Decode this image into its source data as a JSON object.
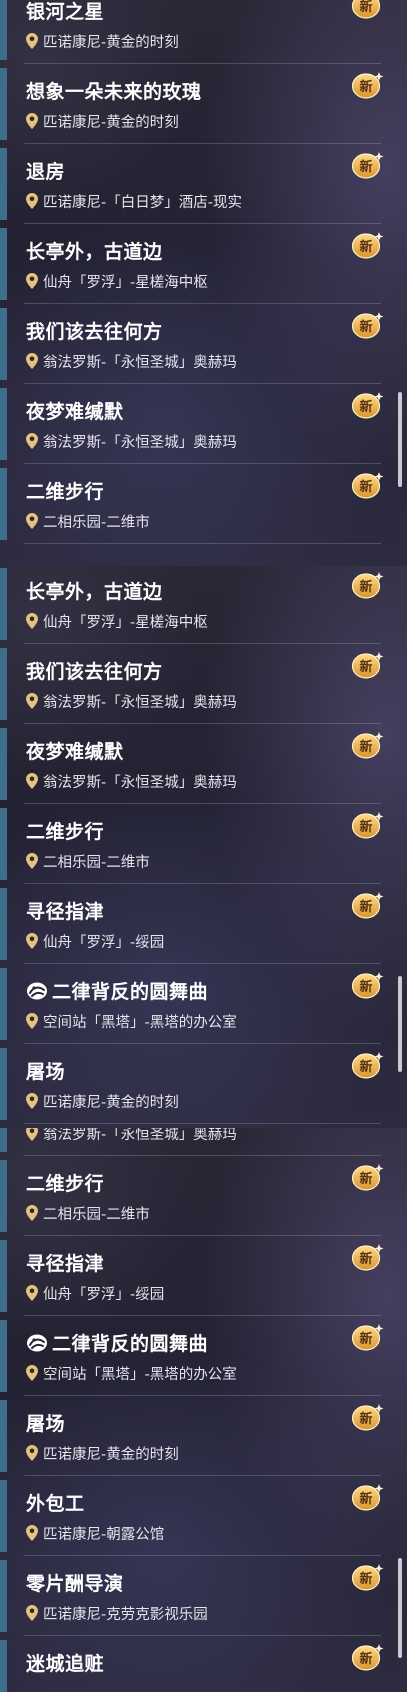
{
  "badge_label": "新",
  "colors": {
    "accent_bar": "#3f6e8c",
    "badge_gold": "#e8b24a",
    "text": "#ffffff",
    "location_text": "#e6e4ec"
  },
  "icons": {
    "location": "map-pin-icon",
    "badge": "new-badge-icon",
    "special_quest": "swirl-quest-icon"
  },
  "screens": [
    {
      "items": [
        {
          "title": "银河之星",
          "location": "匹诺康尼-黄金的时刻"
        },
        {
          "title": "想象一朵未来的玫瑰",
          "location": "匹诺康尼-黄金的时刻"
        },
        {
          "title": "退房",
          "location": "匹诺康尼-「白日梦」酒店-现实"
        },
        {
          "title": "长亭外，古道边",
          "location": "仙舟「罗浮」-星槎海中枢"
        },
        {
          "title": "我们该去往何方",
          "location": "翁法罗斯-「永恒圣城」奥赫玛"
        },
        {
          "title": "夜梦难缄默",
          "location": "翁法罗斯-「永恒圣城」奥赫玛"
        },
        {
          "title": "二维步行",
          "location": "二相乐园-二维市"
        }
      ]
    },
    {
      "items": [
        {
          "title": "长亭外，古道边",
          "location": "仙舟「罗浮」-星槎海中枢"
        },
        {
          "title": "我们该去往何方",
          "location": "翁法罗斯-「永恒圣城」奥赫玛"
        },
        {
          "title": "夜梦难缄默",
          "location": "翁法罗斯-「永恒圣城」奥赫玛"
        },
        {
          "title": "二维步行",
          "location": "二相乐园-二维市"
        },
        {
          "title": "寻径指津",
          "location": "仙舟「罗浮」-绥园"
        },
        {
          "title": "二律背反的圆舞曲",
          "location": "空间站「黑塔」-黑塔的办公室",
          "special": true
        },
        {
          "title": "屠场",
          "location": "匹诺康尼-黄金的时刻"
        }
      ]
    },
    {
      "items": [
        {
          "title": "",
          "location": "翁法罗斯-「永恒圣城」奥赫玛"
        },
        {
          "title": "二维步行",
          "location": "二相乐园-二维市"
        },
        {
          "title": "寻径指津",
          "location": "仙舟「罗浮」-绥园"
        },
        {
          "title": "二律背反的圆舞曲",
          "location": "空间站「黑塔」-黑塔的办公室",
          "special": true
        },
        {
          "title": "屠场",
          "location": "匹诺康尼-黄金的时刻"
        },
        {
          "title": "外包工",
          "location": "匹诺康尼-朝露公馆"
        },
        {
          "title": "零片酬导演",
          "location": "匹诺康尼-克劳克影视乐园"
        },
        {
          "title": "迷城追赃",
          "location": ""
        }
      ]
    }
  ]
}
